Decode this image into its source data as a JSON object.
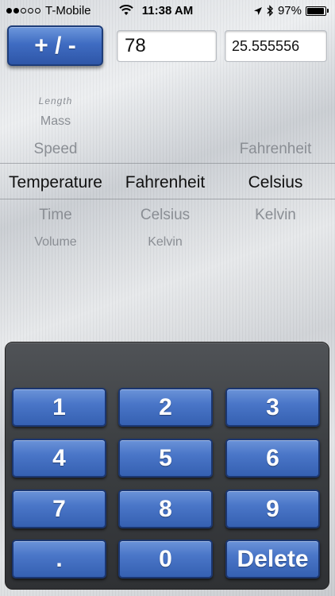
{
  "status_bar": {
    "carrier": "T-Mobile",
    "time": "11:38 AM",
    "battery_text": "97%",
    "battery_level": 0.97,
    "signal_bars_filled": 2,
    "signal_bars_total": 5,
    "icons": [
      "wifi-icon",
      "location-arrow-icon",
      "bluetooth-icon",
      "battery-icon"
    ]
  },
  "top": {
    "sign_button_label": "+ / -",
    "input_value": "78",
    "output_value": "25.555556"
  },
  "picker": {
    "categories": {
      "above": [
        "Length",
        "Mass",
        "Speed"
      ],
      "selected": "Temperature",
      "below": [
        "Time",
        "Volume"
      ]
    },
    "from_units": {
      "above": [],
      "selected": "Fahrenheit",
      "below": [
        "Celsius",
        "Kelvin"
      ]
    },
    "to_units": {
      "above": [
        "Fahrenheit"
      ],
      "selected": "Celsius",
      "below": [
        "Kelvin"
      ]
    }
  },
  "keypad": {
    "keys": [
      "1",
      "2",
      "3",
      "4",
      "5",
      "6",
      "7",
      "8",
      "9",
      ".",
      "0",
      "Delete"
    ]
  },
  "colors": {
    "key_blue": "#4a76c8",
    "keypad_bg": "#3d4043",
    "selected_text": "#111111",
    "unselected_text": "#8a8e94"
  }
}
